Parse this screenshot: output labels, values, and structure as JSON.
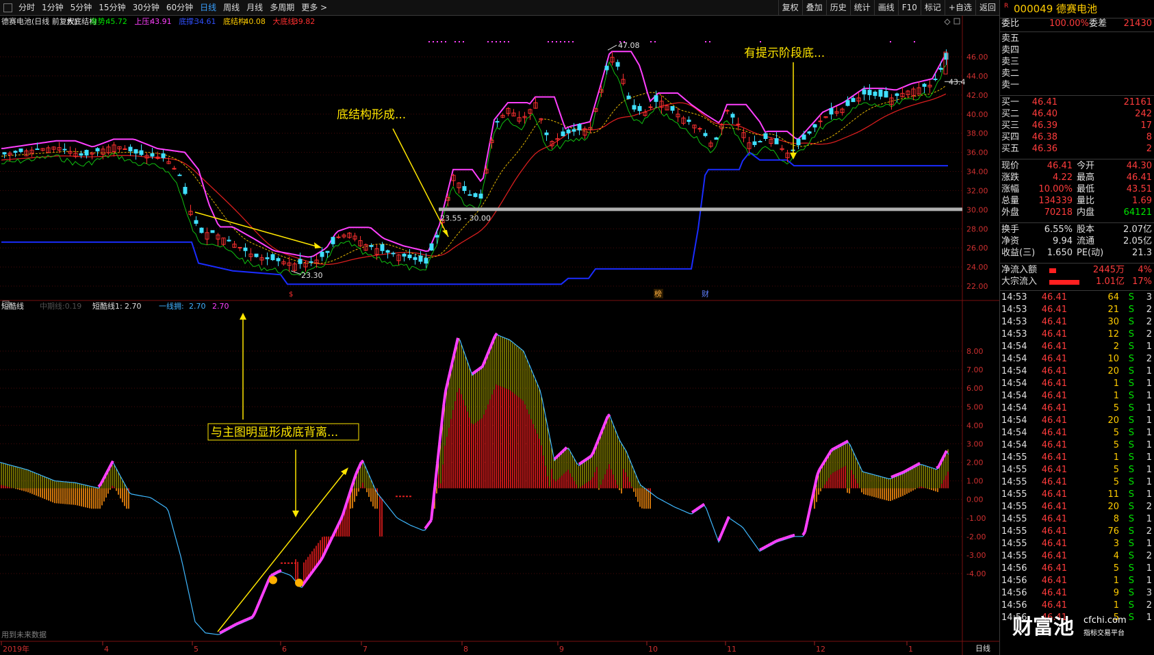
{
  "toolbar": {
    "periods": [
      "分时",
      "1分钟",
      "5分钟",
      "15分钟",
      "30分钟",
      "60分钟",
      "日线",
      "周线",
      "月线",
      "多周期",
      "更多 >"
    ],
    "active": "日线",
    "right": [
      "复权",
      "叠加",
      "历史",
      "统计",
      "画线",
      "F10",
      "标记",
      "+自选",
      "返回"
    ]
  },
  "main_chart": {
    "header": {
      "name": "德赛电池(日线 前复权)",
      "indicator": "大底结构",
      "zs_label": "准势:",
      "zs_val": "45.72",
      "sy_label": "上压:",
      "sy_val": "43.91",
      "dz_label": "底撑:",
      "dz_val": "34.61",
      "djg_label": "底结构:",
      "djg_val": "40.08",
      "ddx_label": "大底线:",
      "ddx_val": "39.82"
    },
    "y_ticks": [
      "46.00",
      "44.00",
      "42.00",
      "40.00",
      "38.00",
      "36.00",
      "34.00",
      "32.00",
      "30.00",
      "28.00",
      "26.00",
      "24.00",
      "22.00"
    ],
    "annotations": {
      "a1": "底结构形成...",
      "a2": "有提示阶段底...",
      "high": "47.08",
      "low": "23.30",
      "range": "23.55 - 30.00",
      "last": "43.4"
    },
    "markers": [
      "$",
      "榜",
      "财"
    ]
  },
  "sub_chart": {
    "header": {
      "name": "短酷线",
      "l1": "中期线",
      "l1_val": "0.19",
      "l2": "短酷线1:",
      "l2_val": "2.70",
      "l3": "一线拥:",
      "l3_val": "2.70",
      "l4": "2.70"
    },
    "y_ticks": [
      "8.00",
      "7.00",
      "6.00",
      "5.00",
      "4.00",
      "3.00",
      "2.00",
      "1.00",
      "0.00",
      "-1.00",
      "-2.00",
      "-3.00",
      "-4.00"
    ],
    "annotation": "与主图明显形成底背离...",
    "footer": "用到未来数据"
  },
  "x_axis": {
    "labels": [
      "2019年",
      "4",
      "5",
      "6",
      "7",
      "8",
      "9",
      "10",
      "11",
      "12",
      "1"
    ],
    "period": "日线"
  },
  "colors": {
    "ma_red": "#d81e1e",
    "ma_yellow": "#e6b800",
    "upper": "#ff40ff",
    "lower_green": "#10c010",
    "support_blue": "#1a2cff",
    "up": "#ff3030",
    "down": "#40e0ff"
  },
  "quote": {
    "code": "000049",
    "name": "德赛电池",
    "r": "R",
    "wb": {
      "label": "委比",
      "val": "100.00%",
      "label2": "委差",
      "val2": "21430"
    },
    "sell": [
      {
        "l": "卖五"
      },
      {
        "l": "卖四"
      },
      {
        "l": "卖三"
      },
      {
        "l": "卖二"
      },
      {
        "l": "卖一"
      }
    ],
    "buy": [
      {
        "l": "买一",
        "p": "46.41",
        "v": "21161"
      },
      {
        "l": "买二",
        "p": "46.40",
        "v": "242"
      },
      {
        "l": "买三",
        "p": "46.39",
        "v": "17"
      },
      {
        "l": "买四",
        "p": "46.38",
        "v": "8"
      },
      {
        "l": "买五",
        "p": "46.36",
        "v": "2"
      }
    ],
    "stats": [
      {
        "l": "现价",
        "v": "46.41",
        "l2": "今开",
        "v2": "44.30"
      },
      {
        "l": "涨跌",
        "v": "4.22",
        "l2": "最高",
        "v2": "46.41"
      },
      {
        "l": "涨幅",
        "v": "10.00%",
        "l2": "最低",
        "v2": "43.51"
      },
      {
        "l": "总量",
        "v": "134339",
        "l2": "量比",
        "v2": "1.69"
      },
      {
        "l": "外盘",
        "v": "70218",
        "l2": "内盘",
        "v2": "64121"
      }
    ],
    "stats2": [
      {
        "l": "换手",
        "v": "6.55%",
        "l2": "股本",
        "v2": "2.07亿"
      },
      {
        "l": "净资",
        "v": "9.94",
        "l2": "流通",
        "v2": "2.05亿"
      },
      {
        "l": "收益(三)",
        "v": "1.650",
        "l2": "PE(动)",
        "v2": "21.3"
      }
    ],
    "flows": [
      {
        "l": "净流入额",
        "v": "2445万",
        "p": "4%"
      },
      {
        "l": "大宗流入",
        "v": "1.01亿",
        "p": "17%"
      }
    ],
    "ticks": [
      [
        "14:53",
        "46.41",
        "64",
        "S",
        "3"
      ],
      [
        "14:53",
        "46.41",
        "21",
        "S",
        "2"
      ],
      [
        "14:53",
        "46.41",
        "30",
        "S",
        "2"
      ],
      [
        "14:53",
        "46.41",
        "12",
        "S",
        "2"
      ],
      [
        "14:54",
        "46.41",
        "2",
        "S",
        "1"
      ],
      [
        "14:54",
        "46.41",
        "10",
        "S",
        "2"
      ],
      [
        "14:54",
        "46.41",
        "20",
        "S",
        "1"
      ],
      [
        "14:54",
        "46.41",
        "1",
        "S",
        "1"
      ],
      [
        "14:54",
        "46.41",
        "1",
        "S",
        "1"
      ],
      [
        "14:54",
        "46.41",
        "5",
        "S",
        "1"
      ],
      [
        "14:54",
        "46.41",
        "20",
        "S",
        "1"
      ],
      [
        "14:54",
        "46.41",
        "5",
        "S",
        "1"
      ],
      [
        "14:54",
        "46.41",
        "5",
        "S",
        "1"
      ],
      [
        "14:55",
        "46.41",
        "1",
        "S",
        "1"
      ],
      [
        "14:55",
        "46.41",
        "5",
        "S",
        "1"
      ],
      [
        "14:55",
        "46.41",
        "5",
        "S",
        "1"
      ],
      [
        "14:55",
        "46.41",
        "11",
        "S",
        "1"
      ],
      [
        "14:55",
        "46.41",
        "20",
        "S",
        "2"
      ],
      [
        "14:55",
        "46.41",
        "8",
        "S",
        "1"
      ],
      [
        "14:55",
        "46.41",
        "76",
        "S",
        "2"
      ],
      [
        "14:55",
        "46.41",
        "3",
        "S",
        "1"
      ],
      [
        "14:55",
        "46.41",
        "4",
        "S",
        "2"
      ],
      [
        "14:56",
        "46.41",
        "5",
        "S",
        "1"
      ],
      [
        "14:56",
        "46.41",
        "1",
        "S",
        "1"
      ],
      [
        "14:56",
        "46.41",
        "9",
        "S",
        "3"
      ],
      [
        "14:56",
        "46.41",
        "1",
        "S",
        "2"
      ],
      [
        "14:56",
        "46.41",
        "5",
        "S",
        "1"
      ]
    ],
    "watermark_cn": "财富池",
    "watermark_url": "cfchi.com",
    "watermark_sub": "指标交易平台"
  }
}
